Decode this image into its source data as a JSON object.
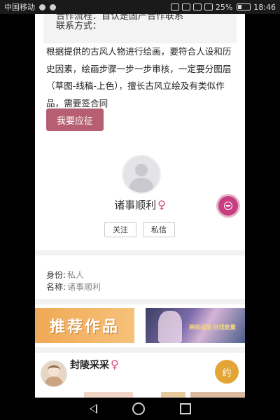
{
  "status_bar": {
    "carrier": "中国移动",
    "battery": "25%",
    "time": "18:46"
  },
  "job": {
    "partial_line": "合作流程：自认是固产合作联系",
    "contact_label": "联系方式：",
    "description": "根据提供的古风人物进行绘画，要符合人设和历史因素，绘画步骤一步一步审核，一定要分图层（草图-线稿-上色），擅长古风立绘及有类似作品，需要签合同",
    "apply_label": "我要应征"
  },
  "profile": {
    "name": "诸事顺利",
    "gender_symbol": "♀",
    "follow_label": "关注",
    "message_label": "私信",
    "identity_label": "身份:",
    "identity_value": "私人",
    "nickname_label": "名称:",
    "nickname_value": "诸事顺利"
  },
  "recommend": {
    "banner_title": "推荐作品",
    "art_banner_text": "美绘战场 好戏能量"
  },
  "artist": {
    "name": "封陵采采",
    "gender_symbol": "♀",
    "invite_label": "约"
  },
  "colors": {
    "apply_button": "#b65f73",
    "female": "#d84f77",
    "float_button": "#c83e80",
    "invite_button": "#e3a536",
    "recommend_banner": "#f0a956"
  }
}
